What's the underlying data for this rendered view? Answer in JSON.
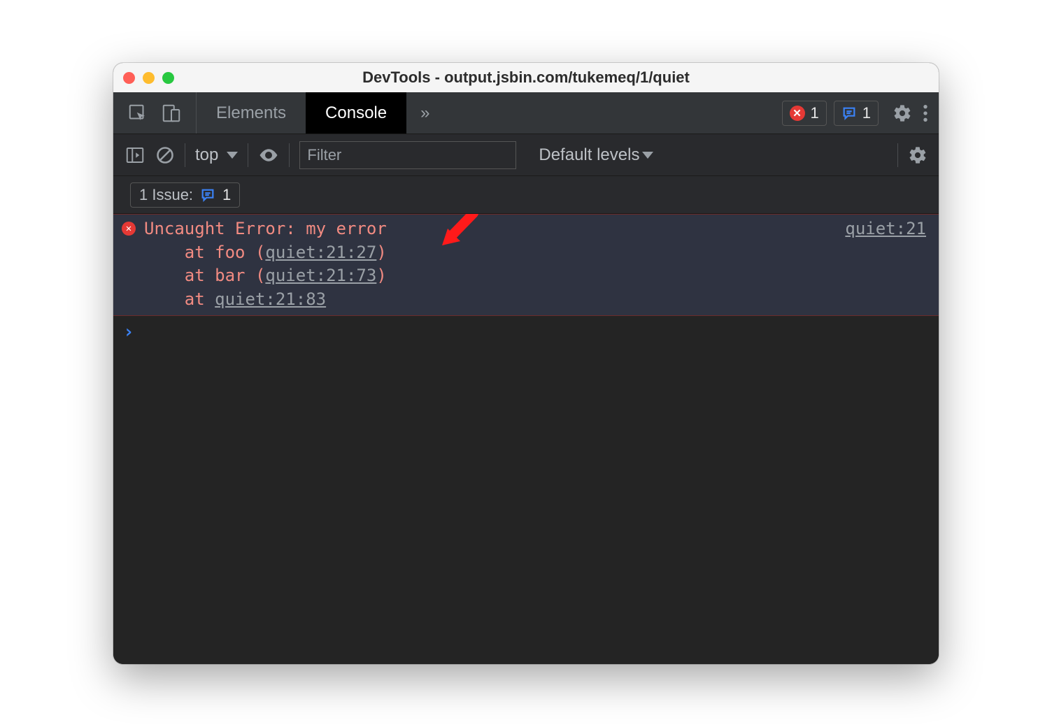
{
  "window": {
    "title": "DevTools - output.jsbin.com/tukemeq/1/quiet"
  },
  "tabs": {
    "elements": "Elements",
    "console": "Console",
    "more_glyph": "»"
  },
  "badges": {
    "error_count": "1",
    "issue_count": "1"
  },
  "toolbar": {
    "context": "top",
    "filter_placeholder": "Filter",
    "levels": "Default levels"
  },
  "issues": {
    "label": "1 Issue:",
    "count": "1"
  },
  "error": {
    "source_link": "quiet:21",
    "message": "Uncaught Error: my error",
    "stack": [
      {
        "prefix": "    at foo (",
        "link": "quiet:21:27",
        "suffix": ")"
      },
      {
        "prefix": "    at bar (",
        "link": "quiet:21:73",
        "suffix": ")"
      },
      {
        "prefix": "    at ",
        "link": "quiet:21:83",
        "suffix": ""
      }
    ]
  },
  "icons": {
    "error_x": "✕",
    "issue_speech": "speech-icon"
  }
}
